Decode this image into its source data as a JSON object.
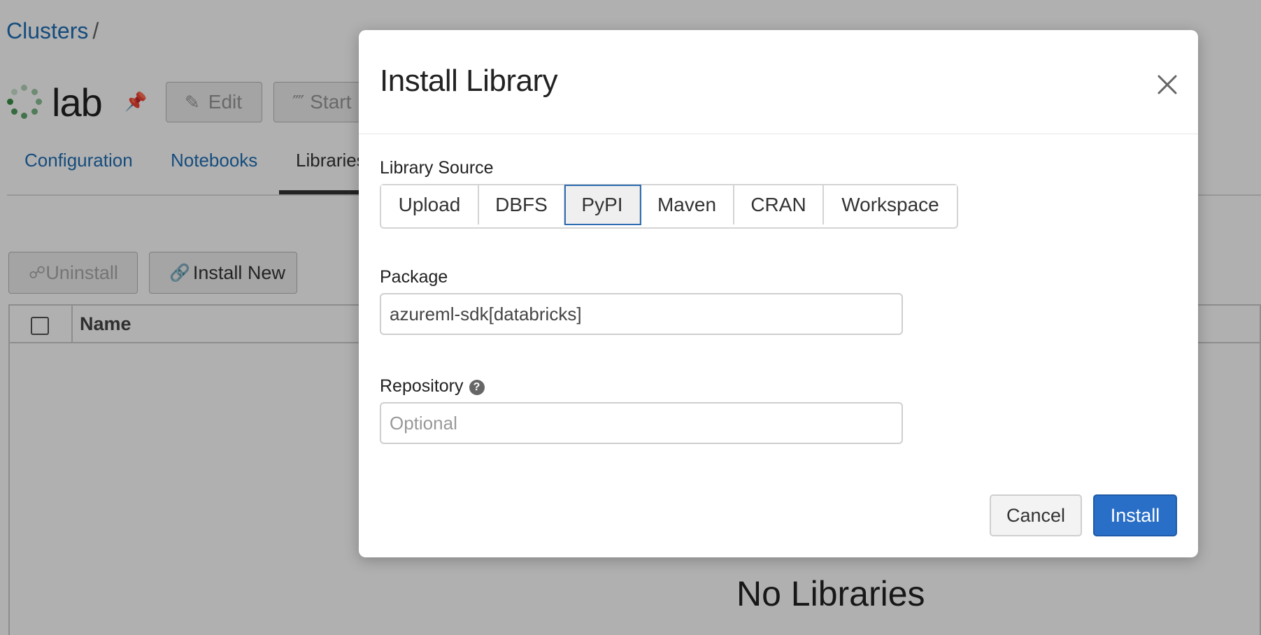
{
  "breadcrumb": {
    "root": "Clusters",
    "separator": "/"
  },
  "cluster": {
    "name": "lab"
  },
  "toolbar": {
    "edit_label": "Edit",
    "start_label": "Start"
  },
  "tabs": [
    {
      "label": "Configuration"
    },
    {
      "label": "Notebooks"
    },
    {
      "label": "Libraries"
    }
  ],
  "libraries": {
    "uninstall_label": "Uninstall",
    "install_new_label": "Install New",
    "table": {
      "columns": [
        "Name"
      ]
    },
    "empty_text": "No Libraries"
  },
  "modal": {
    "title": "Install Library",
    "source_label": "Library Source",
    "sources": [
      {
        "label": "Upload"
      },
      {
        "label": "DBFS"
      },
      {
        "label": "PyPI"
      },
      {
        "label": "Maven"
      },
      {
        "label": "CRAN"
      },
      {
        "label": "Workspace"
      }
    ],
    "selected_source": "PyPI",
    "package": {
      "label": "Package",
      "value": "azureml-sdk[databricks]"
    },
    "repository": {
      "label": "Repository",
      "placeholder": "Optional",
      "value": ""
    },
    "cancel_label": "Cancel",
    "install_label": "Install"
  },
  "colors": {
    "link": "#1f6fb5",
    "primary": "#2a6fc7",
    "selected_border": "#2f6db3"
  }
}
